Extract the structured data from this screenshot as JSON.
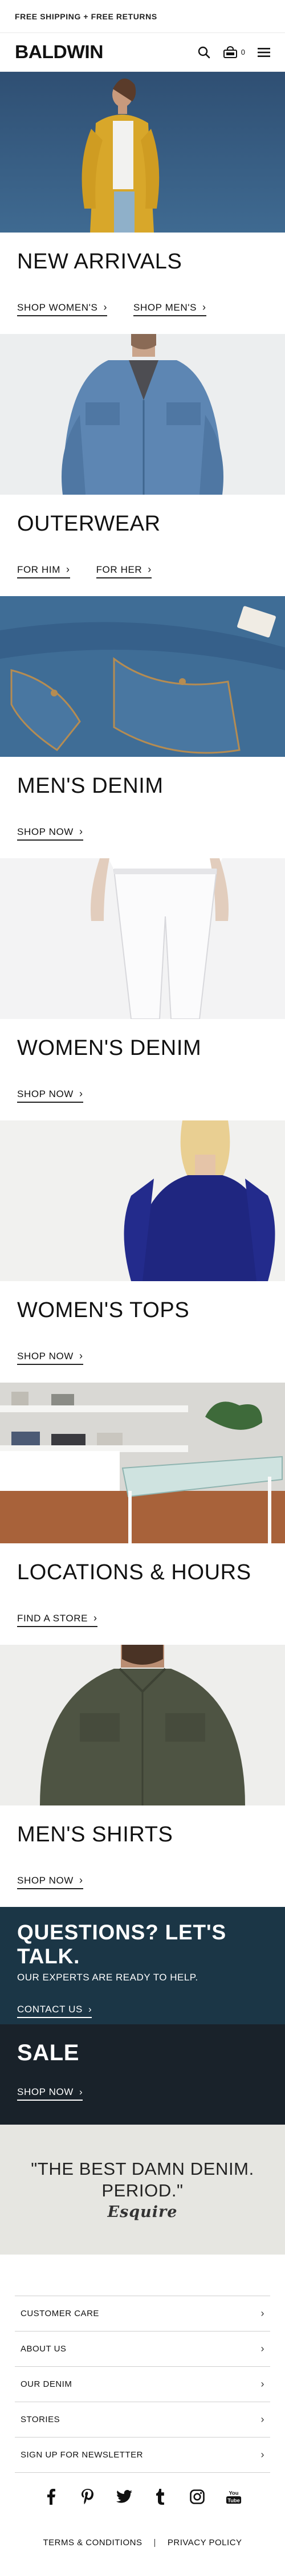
{
  "promo_bar": {
    "text": "FREE SHIPPING + FREE RETURNS"
  },
  "header": {
    "logo": "BALDWIN",
    "bag_count": "0",
    "icons": {
      "search": "search-icon",
      "bag": "shopping-bag-icon",
      "menu": "hamburger-menu-icon"
    }
  },
  "categories": [
    {
      "title": "NEW ARRIVALS",
      "image": "woman-yellow-jacket-photo",
      "links": [
        "SHOP WOMEN'S",
        "SHOP MEN'S"
      ]
    },
    {
      "title": "OUTERWEAR",
      "image": "man-denim-jacket-photo",
      "links": [
        "FOR HIM",
        "FOR HER"
      ]
    },
    {
      "title": "MEN'S DENIM",
      "image": "jeans-pocket-closeup-photo",
      "links": [
        "SHOP NOW"
      ]
    },
    {
      "title": "WOMEN'S DENIM",
      "image": "white-jeans-photo",
      "links": [
        "SHOP NOW"
      ]
    },
    {
      "title": "WOMEN'S TOPS",
      "image": "woman-navy-tee-photo",
      "links": [
        "SHOP NOW"
      ]
    },
    {
      "title": "LOCATIONS & HOURS",
      "image": "store-interior-photo",
      "links": [
        "FIND A STORE"
      ]
    },
    {
      "title": "MEN'S SHIRTS",
      "image": "man-olive-shirt-photo",
      "links": [
        "SHOP NOW"
      ]
    }
  ],
  "questions": {
    "title": "QUESTIONS? LET'S TALK.",
    "subtitle": "OUR EXPERTS ARE READY TO HELP.",
    "link": "CONTACT US",
    "bg_color": "#1b3646"
  },
  "sale": {
    "title": "SALE",
    "link": "SHOP NOW",
    "bg_color": "#19222a"
  },
  "quote": {
    "text": "\"THE BEST DAMN DENIM. PERIOD.\"",
    "source": "Esquire"
  },
  "footer": {
    "items": [
      "CUSTOMER CARE",
      "ABOUT US",
      "OUR DENIM",
      "STORIES",
      "SIGN UP FOR NEWSLETTER"
    ],
    "social": [
      "facebook-icon",
      "pinterest-icon",
      "twitter-icon",
      "tumblr-icon",
      "instagram-icon",
      "youtube-icon"
    ],
    "youtube_label": "You",
    "youtube_label2": "Tube",
    "legal": {
      "terms": "TERMS & CONDITIONS",
      "separator": "|",
      "privacy": "PRIVACY POLICY"
    }
  },
  "chevron": "›",
  "colors": {
    "link_underline": "#222222",
    "quote_bg": "#e6e6e1"
  }
}
